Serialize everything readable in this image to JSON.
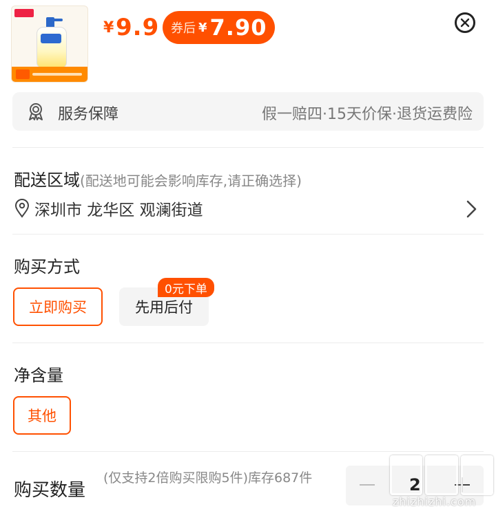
{
  "header": {
    "price_symbol": "¥",
    "price": "9.9",
    "coupon": {
      "label": "券后",
      "symbol": "¥",
      "value": "7.90"
    }
  },
  "service": {
    "label": "服务保障",
    "value": "假一赔四·15天价保·退货运费险"
  },
  "delivery": {
    "title": "配送区域",
    "hint": "(配送地可能会影响库存,请正确选择)",
    "address": "深圳市 龙华区 观澜街道"
  },
  "purchase_method": {
    "title": "购买方式",
    "options": [
      {
        "label": "立即购买",
        "selected": true
      },
      {
        "label": "先用后付",
        "selected": false,
        "badge": "0元下单"
      }
    ]
  },
  "net_content": {
    "title": "净含量",
    "options": [
      {
        "label": "其他",
        "selected": true
      }
    ]
  },
  "quantity": {
    "title": "购买数量",
    "note": "(仅支持2倍购买限购5件)库存687件",
    "value": "2"
  },
  "watermark": {
    "site": "zhizhizhi.com"
  },
  "colors": {
    "accent": "#ff5000",
    "panel": "#f5f5f5"
  },
  "icons": [
    "close-icon",
    "badge-ribbon-icon",
    "location-pin-icon",
    "chevron-right-icon",
    "minus-icon",
    "plus-icon"
  ]
}
